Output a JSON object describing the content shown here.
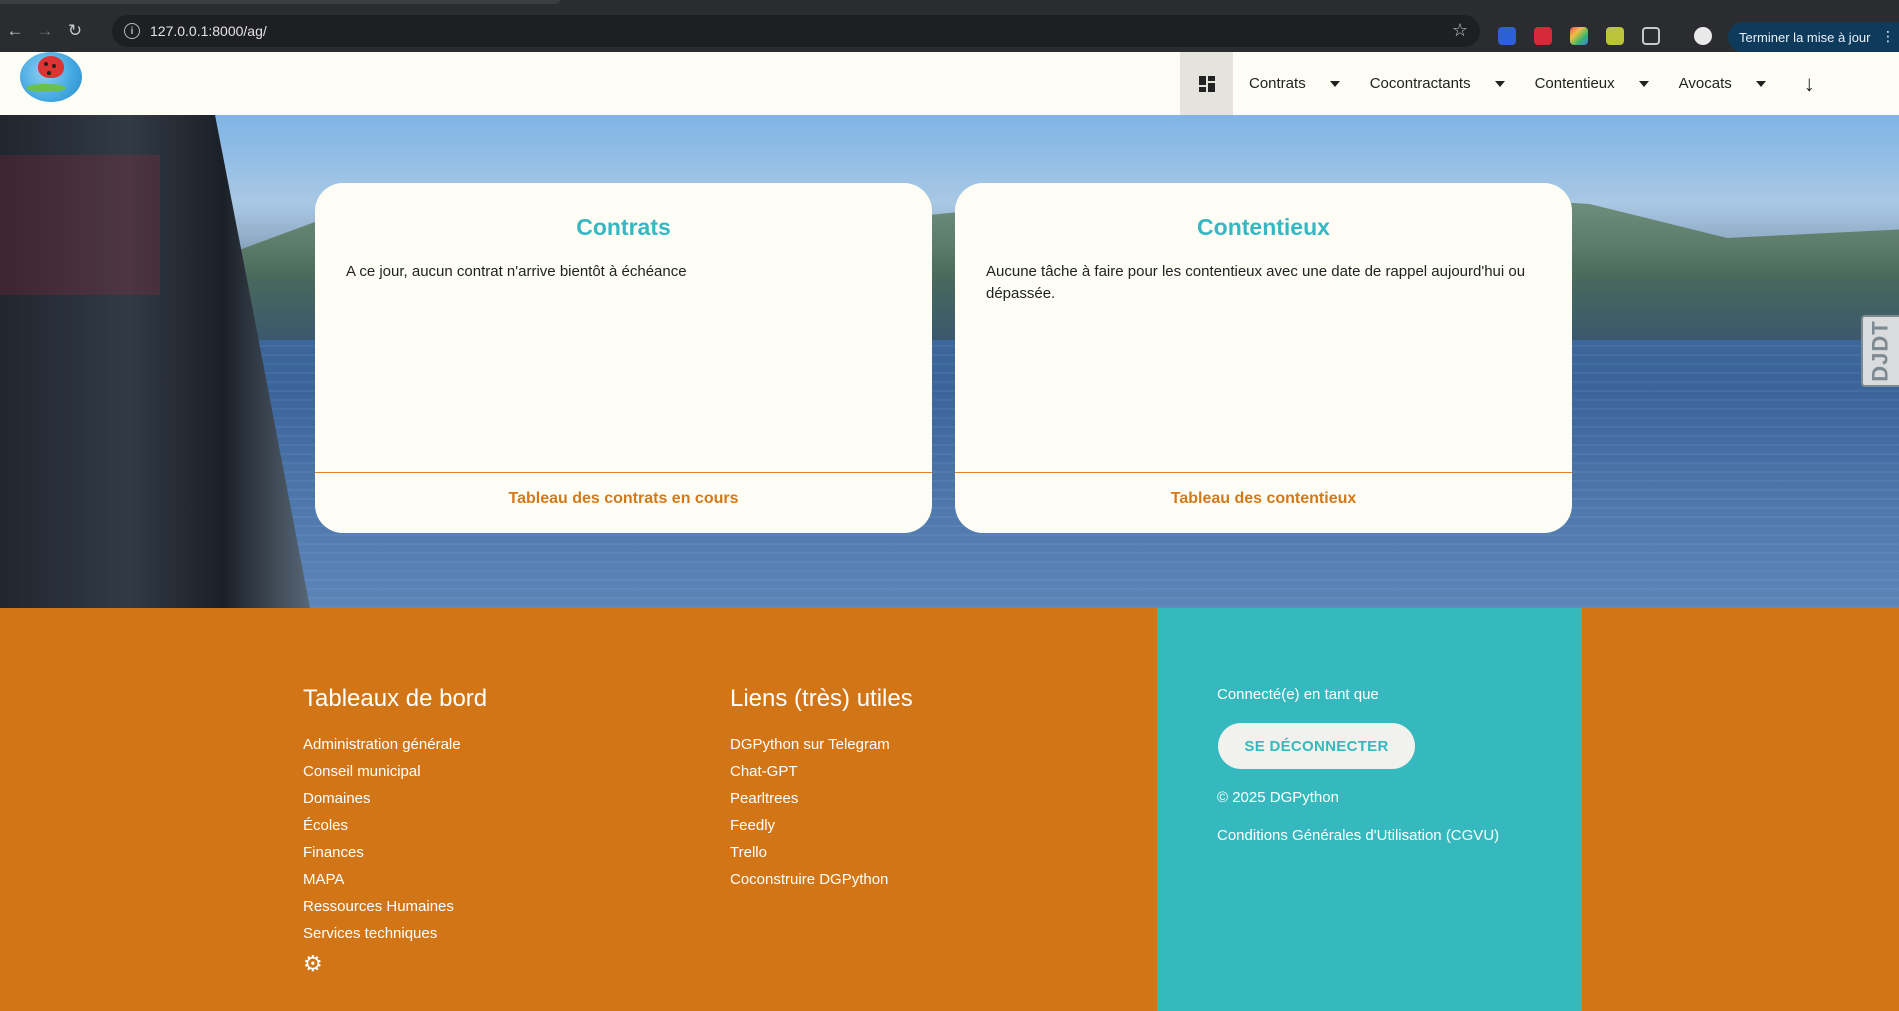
{
  "browser": {
    "url": "127.0.0.1:8000/ag/",
    "update_button": "Terminer la mise à jour"
  },
  "navbar": {
    "menu": [
      {
        "label": "Contrats"
      },
      {
        "label": "Cocontractants"
      },
      {
        "label": "Contentieux"
      },
      {
        "label": "Avocats"
      }
    ]
  },
  "debug_toolbar": {
    "label": "DJDT"
  },
  "cards": [
    {
      "title": "Contrats",
      "text": "A ce jour, aucun contrat n'arrive bientôt à échéance",
      "link": "Tableau des contrats en cours"
    },
    {
      "title": "Contentieux",
      "text": "Aucune tâche à faire pour les contentieux avec une date de rappel aujourd'hui ou dépassée.",
      "link": "Tableau des contentieux"
    }
  ],
  "footer": {
    "dashboards": {
      "title": "Tableaux de bord",
      "items": [
        "Administration générale",
        "Conseil municipal",
        "Domaines",
        "Écoles",
        "Finances",
        "MAPA",
        "Ressources Humaines",
        "Services techniques"
      ]
    },
    "links": {
      "title": "Liens (très) utiles",
      "items": [
        "DGPython sur Telegram",
        "Chat-GPT",
        "Pearltrees",
        "Feedly",
        "Trello",
        "Coconstruire DGPython"
      ]
    },
    "account": {
      "connected_as": "Connecté(e) en tant que",
      "logout": "SE DÉCONNECTER",
      "copyright": "© 2025 DGPython",
      "cgvu": "Conditions Générales d'Utilisation (CGVU)"
    }
  },
  "colors": {
    "accent_teal": "#35b9be",
    "accent_orange": "#d27516",
    "card_bg": "#fdfdf5"
  }
}
